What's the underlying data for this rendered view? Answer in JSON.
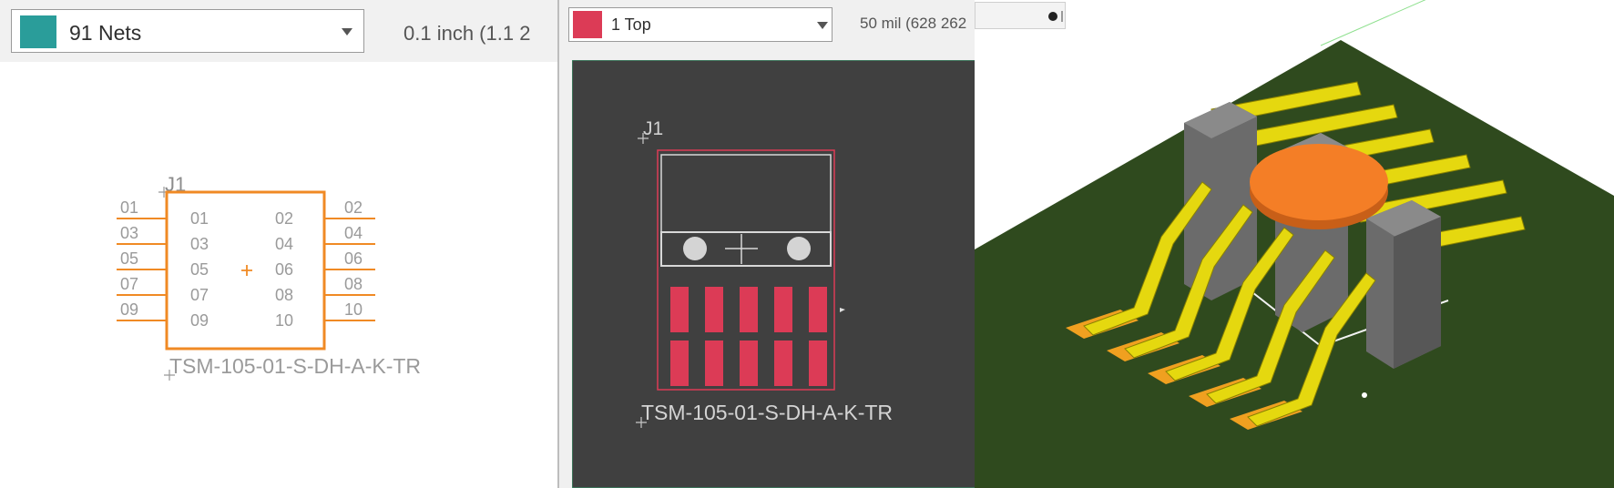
{
  "schematic": {
    "net_selector": {
      "label": "91 Nets",
      "swatch_color": "#2a9d9a"
    },
    "grid_readout": "0.1 inch (1.1 2",
    "part": {
      "name": "J1",
      "value": "TSM-105-01-S-DH-A-K-TR",
      "outline_color": "#f08a24",
      "left_pins": [
        "01",
        "03",
        "05",
        "07",
        "09"
      ],
      "right_pins": [
        "02",
        "04",
        "06",
        "08",
        "10"
      ],
      "inner_left": [
        "01",
        "03",
        "05",
        "07",
        "09"
      ],
      "inner_right": [
        "02",
        "04",
        "06",
        "08",
        "10"
      ]
    }
  },
  "board": {
    "layer_selector": {
      "label": "1 Top",
      "swatch_color": "#dc3b56"
    },
    "grid_readout": "50 mil (628 262",
    "footprint": {
      "name": "J1",
      "value": "TSM-105-01-S-DH-A-K-TR",
      "pad_color": "#dc3b56",
      "background": "#404040",
      "pad_rows": 2,
      "pads_per_row": 5
    }
  },
  "view3d": {
    "board_color": "#2f4a1e",
    "lead_color": "#e5d80f",
    "pad_color": "#f0a020",
    "body_color": "#6b6b6b",
    "cap_color": "#f47e26",
    "lead_pairs": 5
  }
}
